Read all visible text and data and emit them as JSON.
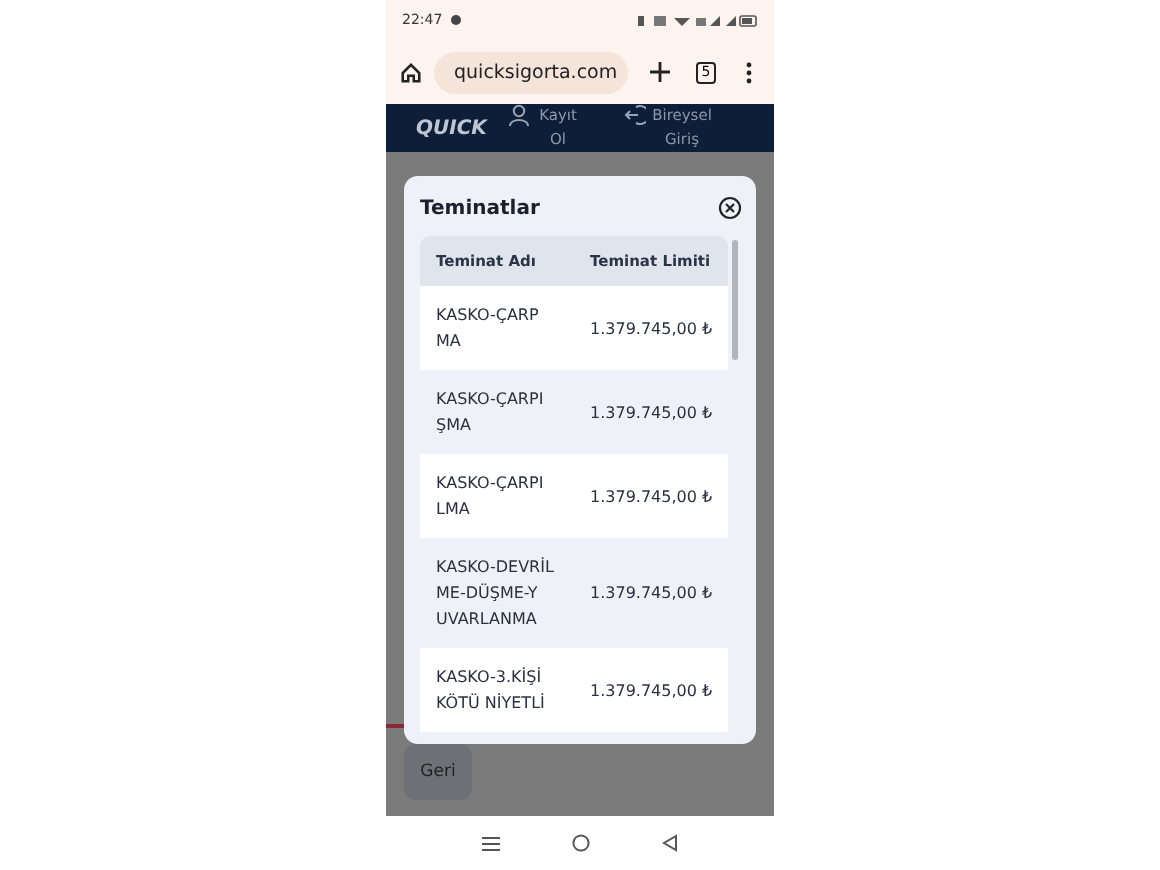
{
  "status_bar": {
    "time": "22:47"
  },
  "browser": {
    "url": "quicksigorta.com",
    "tab_count": "5"
  },
  "site_nav": {
    "logo": "QUICK",
    "items": [
      {
        "kind": "user",
        "label": "Kayıt Ol"
      },
      {
        "kind": "login",
        "label": "Bireysel Giriş"
      }
    ]
  },
  "modal": {
    "title": "Teminatlar",
    "columns": [
      "Teminat Adı",
      "Teminat Limiti"
    ],
    "rows": [
      {
        "name_lines": [
          "KASKO-ÇARP",
          "MA"
        ],
        "limit": "1.379.745,00 ₺"
      },
      {
        "name_lines": [
          "KASKO-ÇARPI",
          "ŞMA"
        ],
        "limit": "1.379.745,00 ₺"
      },
      {
        "name_lines": [
          "KASKO-ÇARPI",
          "LMA"
        ],
        "limit": "1.379.745,00 ₺"
      },
      {
        "name_lines": [
          "KASKO-DEVRİL",
          "ME-DÜŞME-Y",
          "UVARLANMA"
        ],
        "limit": "1.379.745,00 ₺"
      },
      {
        "name_lines": [
          "KASKO-3.KİŞİ",
          "KÖTÜ NİYETLİ"
        ],
        "limit": "1.379.745,00 ₺"
      }
    ]
  },
  "back_button": "Geri"
}
